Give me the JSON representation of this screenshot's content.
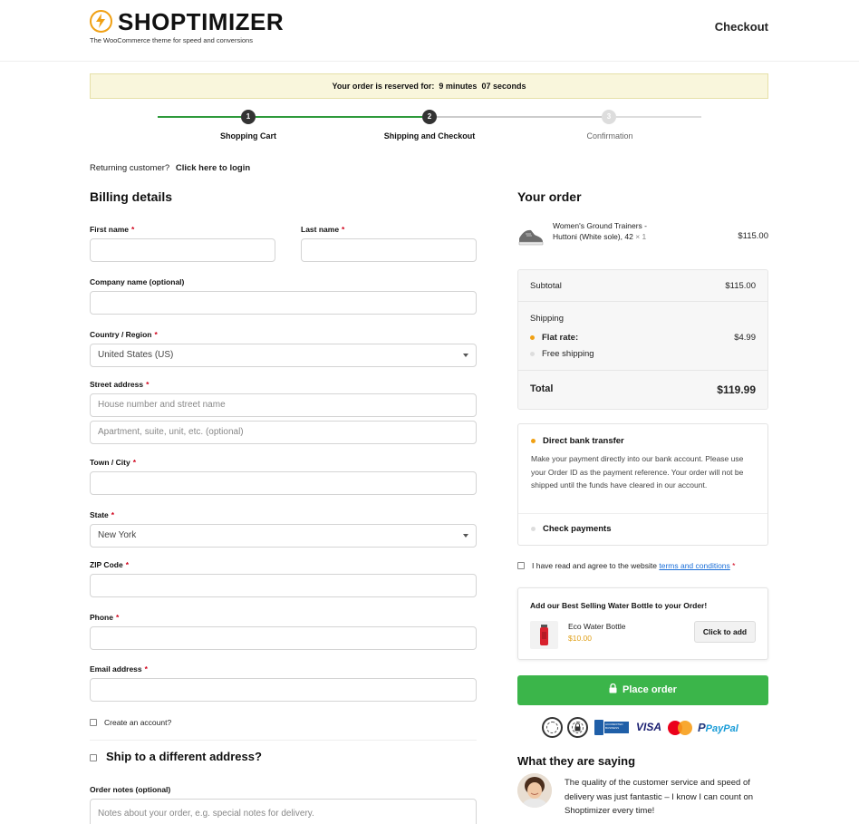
{
  "header": {
    "logo": "SHOPTIMIZER",
    "tagline": "The WooCommerce theme for speed and conversions",
    "page_label": "Checkout"
  },
  "timer": {
    "text": "Your order is reserved for:",
    "minutes": "9 minutes",
    "seconds": "07 seconds"
  },
  "steps": [
    {
      "number": "1",
      "label": "Shopping Cart",
      "state": "done"
    },
    {
      "number": "2",
      "label": "Shipping and Checkout",
      "state": "current"
    },
    {
      "number": "3",
      "label": "Confirmation",
      "state": "todo"
    }
  ],
  "returning": {
    "text": "Returning customer?",
    "link": "Click here to login"
  },
  "billing": {
    "title": "Billing details",
    "first_name": "First name",
    "last_name": "Last name",
    "company": "Company name (optional)",
    "country_label": "Country / Region",
    "country_value": "United States (US)",
    "street_label": "Street address",
    "street_placeholder1": "House number and street name",
    "street_placeholder2": "Apartment, suite, unit, etc. (optional)",
    "city": "Town / City",
    "state_label": "State",
    "state_value": "New York",
    "zip": "ZIP Code",
    "phone": "Phone",
    "email": "Email address",
    "create_account": "Create an account?",
    "ship_different": "Ship to a different address?",
    "notes_label": "Order notes (optional)",
    "notes_placeholder": "Notes about your order, e.g. special notes for delivery.",
    "required_mark": "*"
  },
  "order": {
    "title": "Your order",
    "item_name": "Women's Ground Trainers - Huttoni (White sole), 42",
    "item_qty": "× 1",
    "item_price": "$115.00",
    "subtotal_label": "Subtotal",
    "subtotal_value": "$115.00",
    "shipping_label": "Shipping",
    "flat_rate_label": "Flat rate:",
    "flat_rate_value": "$4.99",
    "free_shipping_label": "Free shipping",
    "total_label": "Total",
    "total_value": "$119.99"
  },
  "payment": {
    "bank_title": "Direct bank transfer",
    "bank_desc": "Make your payment directly into our bank account. Please use your Order ID as the payment reference. Your order will not be shipped until the funds have cleared in our account.",
    "check_title": "Check payments"
  },
  "terms": {
    "text": "I have read and agree to the website",
    "link": "terms and conditions",
    "req": "*"
  },
  "upsell": {
    "title": "Add our Best Selling Water Bottle to your Order!",
    "name": "Eco Water Bottle",
    "price": "$10.00",
    "button": "Click to add"
  },
  "place_order": "Place order",
  "trust": {
    "visa": "VISA",
    "paypal": "PayPal",
    "accredited": "ACCREDITED BUSINESS"
  },
  "testimonial": {
    "title": "What they are saying",
    "text": "The quality of the customer service and speed of delivery was just fantastic – I know I can count on Shoptimizer every time!"
  },
  "colors": {
    "accent": "#3bb54a",
    "brand": "#f0a013",
    "timer_bg": "#f9f6dc",
    "step_done": "#2e9a3b"
  }
}
